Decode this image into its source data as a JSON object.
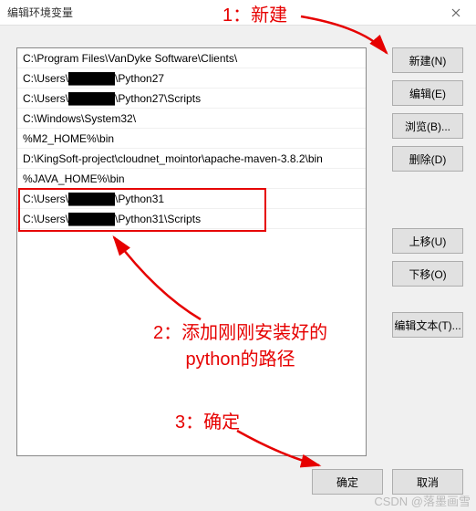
{
  "titlebar": {
    "title": "编辑环境变量"
  },
  "list": {
    "items": [
      "C:\\Program Files\\VanDyke Software\\Clients\\",
      "C:\\Users\\██████\\Python27",
      "C:\\Users\\██████\\Python27\\Scripts",
      "C:\\Windows\\System32\\",
      "%M2_HOME%\\bin",
      "D:\\KingSoft-project\\cloudnet_mointor\\apache-maven-3.8.2\\bin",
      "%JAVA_HOME%\\bin",
      "C:\\Users\\██████\\Python31",
      "C:\\Users\\██████\\Python31\\Scripts"
    ]
  },
  "buttons": {
    "new": "新建(N)",
    "edit": "编辑(E)",
    "browse": "浏览(B)...",
    "delete": "删除(D)",
    "moveup": "上移(U)",
    "movedown": "下移(O)",
    "edittext": "编辑文本(T)...",
    "ok": "确定",
    "cancel": "取消"
  },
  "annotations": {
    "a1": "1：新建",
    "a2_line1": "2：添加刚刚安装好的",
    "a2_line2": "python的路径",
    "a3": "3：确定"
  },
  "watermark": "CSDN @落墨画雪"
}
